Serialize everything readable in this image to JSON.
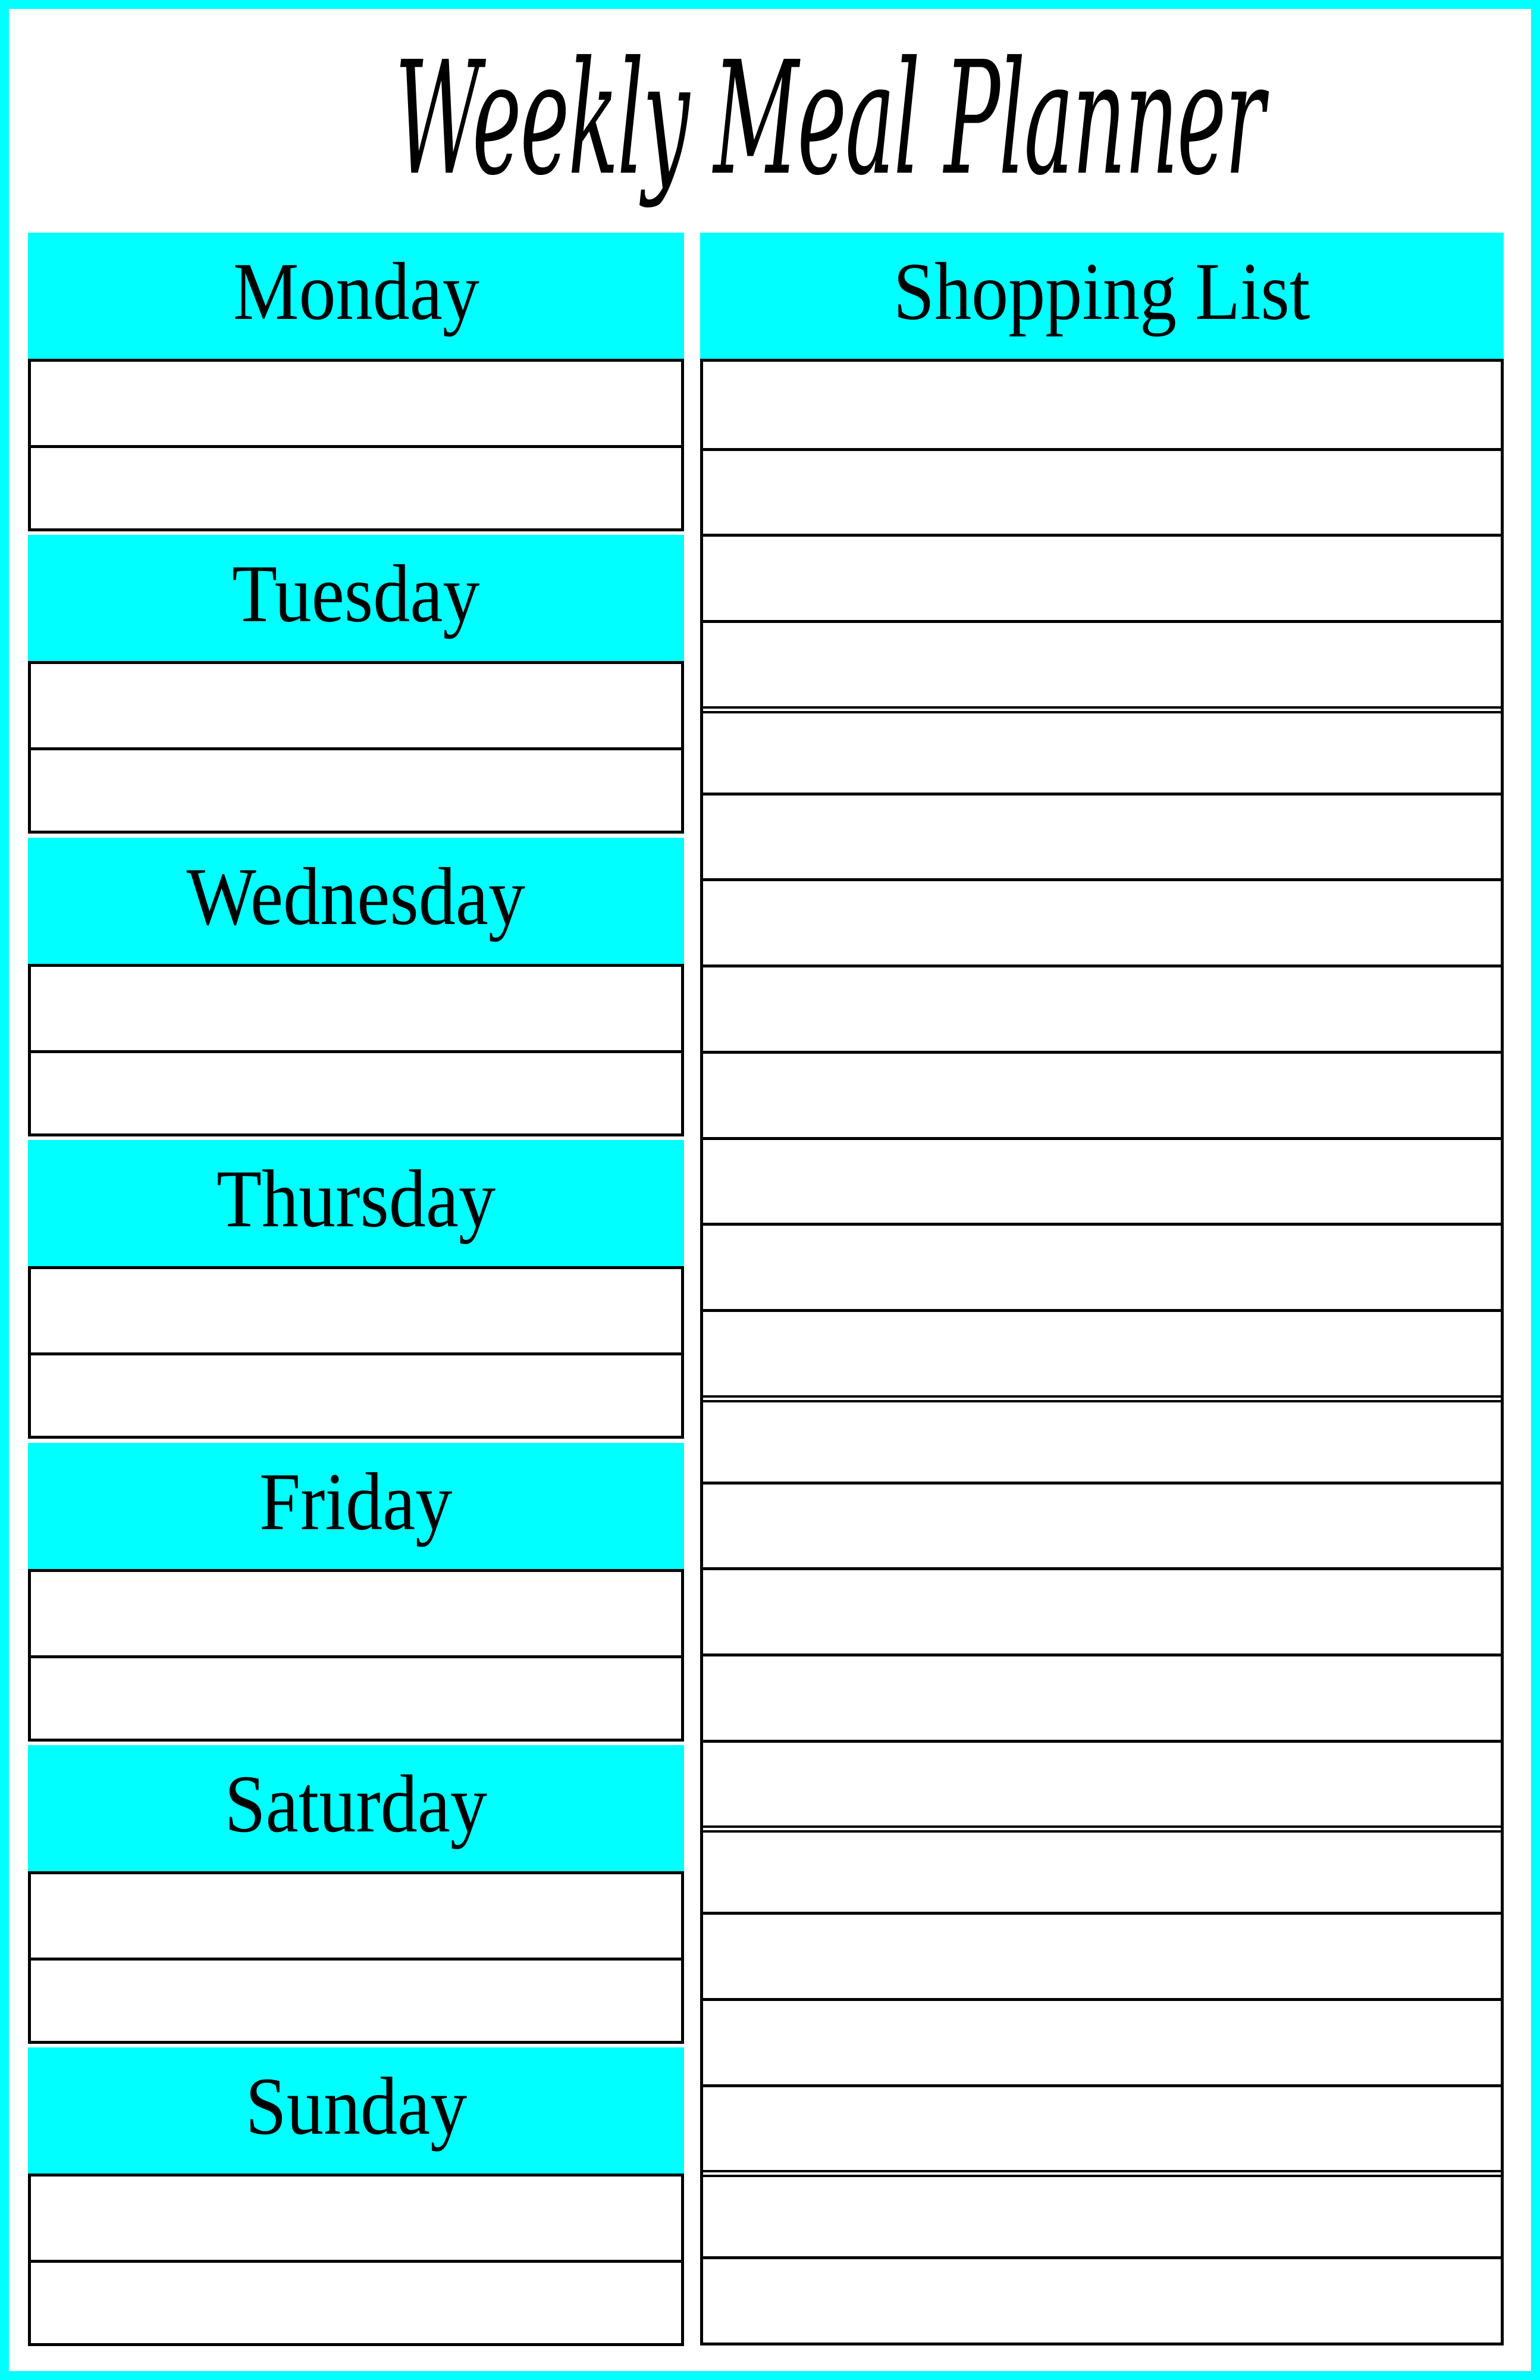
{
  "page": {
    "title": "Weekly Meal Planner",
    "colors": {
      "accent": "#00FFFF",
      "line": "#000000",
      "background": "#FFFFFF"
    }
  },
  "days": [
    {
      "label": "Monday",
      "entries": [
        "",
        ""
      ]
    },
    {
      "label": "Tuesday",
      "entries": [
        "",
        ""
      ]
    },
    {
      "label": "Wednesday",
      "entries": [
        "",
        ""
      ]
    },
    {
      "label": "Thursday",
      "entries": [
        "",
        ""
      ]
    },
    {
      "label": "Friday",
      "entries": [
        "",
        ""
      ]
    },
    {
      "label": "Saturday",
      "entries": [
        "",
        ""
      ]
    },
    {
      "label": "Sunday",
      "entries": [
        "",
        ""
      ]
    }
  ],
  "shopping_list": {
    "label": "Shopping List",
    "row_count": 23,
    "items": [
      "",
      "",
      "",
      "",
      "",
      "",
      "",
      "",
      "",
      "",
      "",
      "",
      "",
      "",
      "",
      "",
      "",
      "",
      "",
      "",
      "",
      "",
      ""
    ],
    "group_breaks_after_rows": [
      4,
      12,
      17,
      21
    ]
  }
}
